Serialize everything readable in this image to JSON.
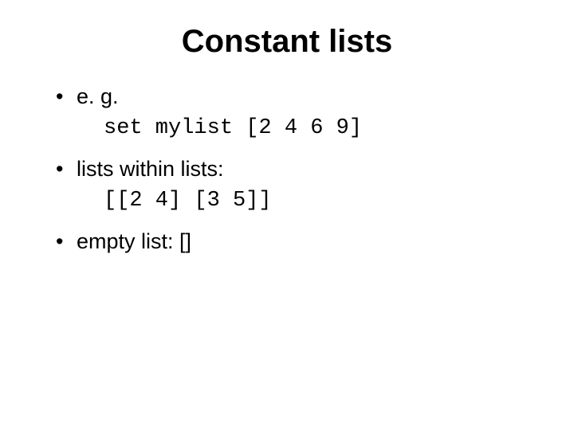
{
  "title": "Constant lists",
  "bullets": [
    {
      "text": "e. g.",
      "sub_mono": "set mylist [2 4 6 9]"
    },
    {
      "text": "lists within lists:",
      "sub_mono": "[[2 4] [3 5]]"
    },
    {
      "text": "empty list: []"
    }
  ]
}
